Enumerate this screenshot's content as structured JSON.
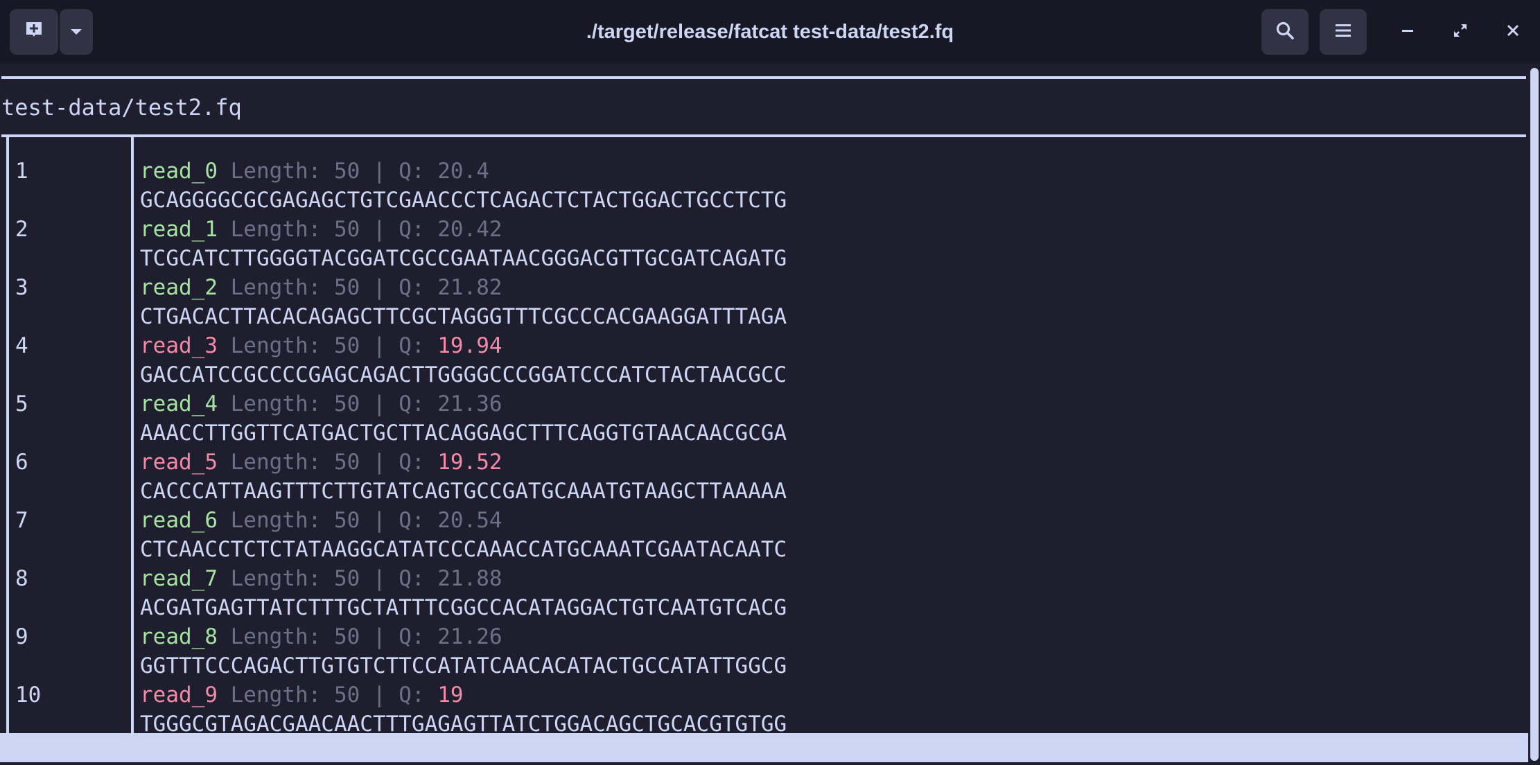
{
  "window": {
    "title": "./target/release/fatcat test-data/test2.fq"
  },
  "icons": {
    "new_tab": "new-tab-icon",
    "dropdown": "chevron-down-icon",
    "search": "search-icon",
    "menu": "hamburger-menu-icon",
    "minimize": "minimize-icon",
    "maximize": "maximize-icon",
    "close": "close-icon"
  },
  "file": {
    "name": "test-data/test2.fq"
  },
  "reads": [
    {
      "num": "1",
      "name": "read_0",
      "length_label": " Length: 50 | Q: ",
      "q": "20.4",
      "low": false,
      "seq": "GCAGGGGCGCGAGAGCTGTCGAACCCTCAGACTCTACTGGACTGCCTCTG"
    },
    {
      "num": "2",
      "name": "read_1",
      "length_label": " Length: 50 | Q: ",
      "q": "20.42",
      "low": false,
      "seq": "TCGCATCTTGGGGTACGGATCGCCGAATAACGGGACGTTGCGATCAGATG"
    },
    {
      "num": "3",
      "name": "read_2",
      "length_label": " Length: 50 | Q: ",
      "q": "21.82",
      "low": false,
      "seq": "CTGACACTTACACAGAGCTTCGCTAGGGTTTCGCCCACGAAGGATTTAGA"
    },
    {
      "num": "4",
      "name": "read_3",
      "length_label": " Length: 50 | Q: ",
      "q": "19.94",
      "low": true,
      "seq": "GACCATCCGCCCCGAGCAGACTTGGGGCCCGGATCCCATCTACTAACGCC"
    },
    {
      "num": "5",
      "name": "read_4",
      "length_label": " Length: 50 | Q: ",
      "q": "21.36",
      "low": false,
      "seq": "AAACCTTGGTTCATGACTGCTTACAGGAGCTTTCAGGTGTAACAACGCGA"
    },
    {
      "num": "6",
      "name": "read_5",
      "length_label": " Length: 50 | Q: ",
      "q": "19.52",
      "low": true,
      "seq": "CACCCATTAAGTTTCTTGTATCAGTGCCGATGCAAATGTAAGCTTAAAAA"
    },
    {
      "num": "7",
      "name": "read_6",
      "length_label": " Length: 50 | Q: ",
      "q": "20.54",
      "low": false,
      "seq": "CTCAACCTCTCTATAAGGCATATCCCAAACCATGCAAATCGAATACAATC"
    },
    {
      "num": "8",
      "name": "read_7",
      "length_label": " Length: 50 | Q: ",
      "q": "21.88",
      "low": false,
      "seq": "ACGATGAGTTATCTTTGCTATTTCGGCCACATAGGACTGTCAATGTCACG"
    },
    {
      "num": "9",
      "name": "read_8",
      "length_label": " Length: 50 | Q: ",
      "q": "21.26",
      "low": false,
      "seq": "GGTTTCCCAGACTTGTGTCTTCCATATCAACACATACTGCCATATTGGCG"
    },
    {
      "num": "10",
      "name": "read_9",
      "length_label": " Length: 50 | Q: ",
      "q": "19",
      "low": true,
      "seq": "TGGGCGTAGACGAACAACTTTGAGAGTTATCTGGACAGCTGCACGTGTGG"
    }
  ],
  "status": {
    "app_name": "fatcat"
  },
  "colors": {
    "background": "#1e1e2e",
    "foreground": "#cdd6f4",
    "good_read": "#a6e3a1",
    "low_quality": "#f38ba8",
    "meta": "#6c7086"
  }
}
